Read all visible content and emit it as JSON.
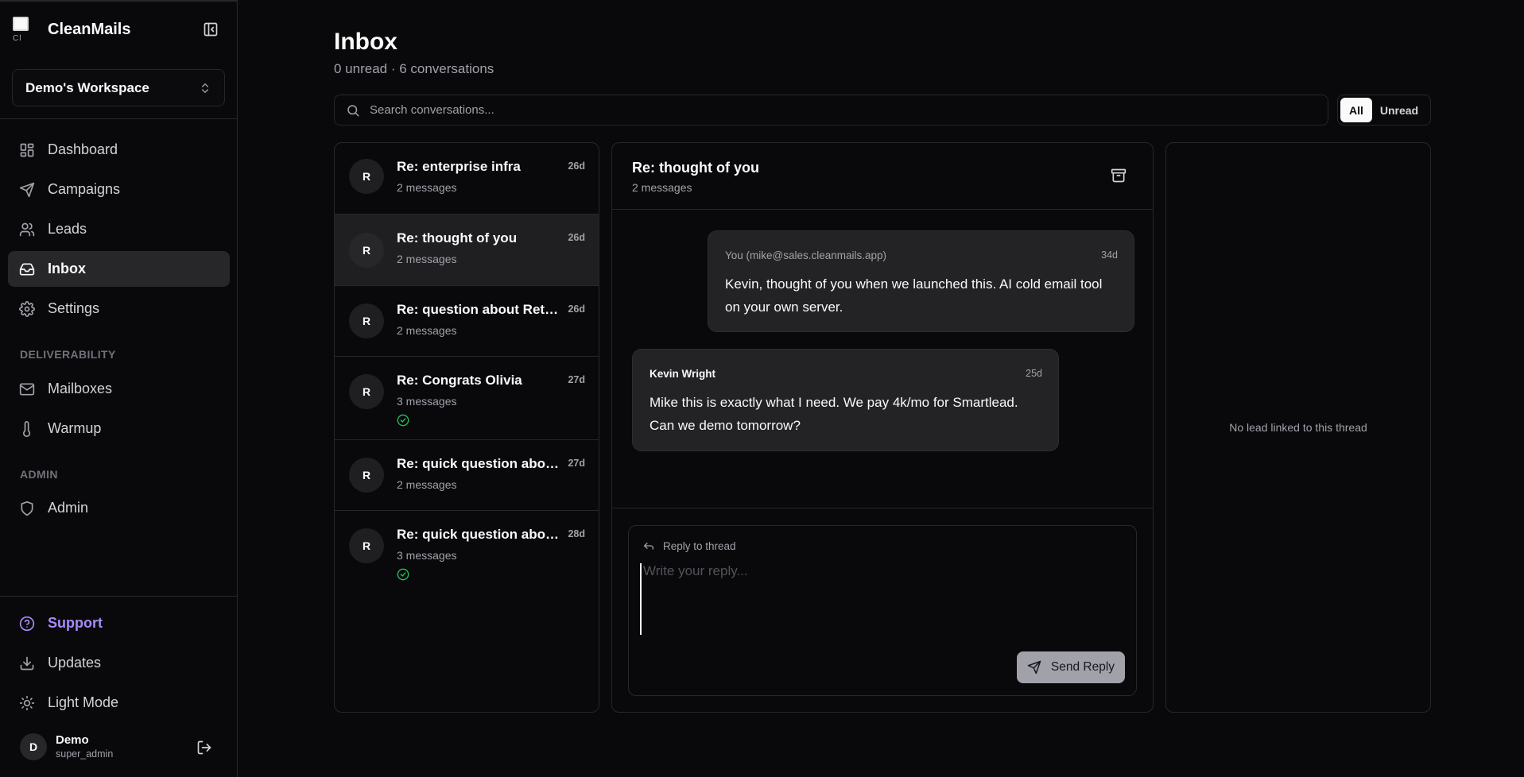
{
  "app": {
    "name": "CleanMails"
  },
  "workspace": {
    "name": "Demo's Workspace"
  },
  "nav": {
    "main": [
      {
        "label": "Dashboard",
        "icon": "dashboard-icon"
      },
      {
        "label": "Campaigns",
        "icon": "send-icon"
      },
      {
        "label": "Leads",
        "icon": "users-icon"
      },
      {
        "label": "Inbox",
        "icon": "inbox-icon",
        "active": true
      },
      {
        "label": "Settings",
        "icon": "gear-icon"
      }
    ],
    "deliverability_label": "DELIVERABILITY",
    "deliverability": [
      {
        "label": "Mailboxes",
        "icon": "mail-icon"
      },
      {
        "label": "Warmup",
        "icon": "thermometer-icon"
      }
    ],
    "admin_label": "ADMIN",
    "admin": [
      {
        "label": "Admin",
        "icon": "shield-icon"
      }
    ],
    "bottom": [
      {
        "label": "Support",
        "icon": "help-icon"
      },
      {
        "label": "Updates",
        "icon": "download-icon"
      },
      {
        "label": "Light Mode",
        "icon": "sun-icon"
      }
    ]
  },
  "user": {
    "initial": "D",
    "name": "Demo",
    "role": "super_admin"
  },
  "inbox": {
    "title": "Inbox",
    "subtitle": "0 unread · 6 conversations",
    "search_placeholder": "Search conversations...",
    "filters": {
      "all": "All",
      "unread": "Unread",
      "selected": "All"
    }
  },
  "conversations": [
    {
      "initial": "R",
      "subject": "Re: enterprise infra",
      "count": "2 messages",
      "time": "26d",
      "replied": false
    },
    {
      "initial": "R",
      "subject": "Re: thought of you",
      "count": "2 messages",
      "time": "26d",
      "replied": false,
      "selected": true
    },
    {
      "initial": "R",
      "subject": "Re: question about Retool",
      "count": "2 messages",
      "time": "26d",
      "replied": false
    },
    {
      "initial": "R",
      "subject": "Re: Congrats Olivia",
      "count": "3 messages",
      "time": "27d",
      "replied": true
    },
    {
      "initial": "R",
      "subject": "Re: quick question abou...",
      "count": "2 messages",
      "time": "27d",
      "replied": false
    },
    {
      "initial": "R",
      "subject": "Re: quick question abou...",
      "count": "3 messages",
      "time": "28d",
      "replied": true
    }
  ],
  "thread": {
    "title": "Re: thought of you",
    "count": "2 messages",
    "messages": [
      {
        "from": "You (mike@sales.cleanmails.app)",
        "time": "34d",
        "body": "Kevin, thought of you when we launched this. AI cold email tool on your own server.",
        "outgoing": true
      },
      {
        "from": "Kevin Wright",
        "time": "25d",
        "body": "Mike this is exactly what I need. We pay 4k/mo for Smartlead. Can we demo tomorrow?",
        "outgoing": false
      }
    ],
    "reply_label": "Reply to thread",
    "reply_placeholder": "Write your reply...",
    "send_label": "Send Reply"
  },
  "lead_panel": {
    "empty_text": "No lead linked to this thread"
  }
}
